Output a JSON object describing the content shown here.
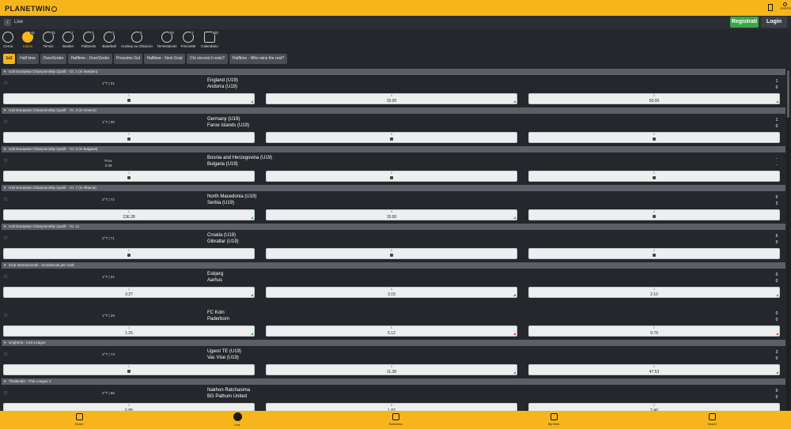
{
  "header": {
    "logo_text": "PLANETWIN",
    "user_label": "OSPITE"
  },
  "subbar": {
    "back": "‹",
    "title": "Live",
    "register": "Registrati",
    "login": "Login"
  },
  "sports": [
    {
      "label": "Cerca",
      "count": ""
    },
    {
      "label": "Calcio",
      "count": "40"
    },
    {
      "label": "Tennis",
      "count": "33"
    },
    {
      "label": "Basket",
      "count": "2"
    },
    {
      "label": "Pallavolo",
      "count": "1"
    },
    {
      "label": "Baseball",
      "count": "1"
    },
    {
      "label": "Hockey su Ghiaccio",
      "count": "4"
    },
    {
      "label": "Tennistavolo",
      "count": "53"
    },
    {
      "label": "Freccette",
      "count": "1"
    },
    {
      "label": "Calendario",
      "count": "487"
    }
  ],
  "tabs": [
    "1x2",
    "Half time",
    "Over/Under",
    "Halftime - Over/Under",
    "Prossimo Gol",
    "Halftime - Next Goal",
    "Chi vincerà il resto?",
    "Halftime - Who wins the rest?"
  ],
  "odd_headers": [
    "1",
    "X",
    "2"
  ],
  "events": [
    {
      "league": "U19 European Championship Qualif. - Gr. 1 (in Sweden)",
      "time": "1°T | 31",
      "time2": "",
      "home": "England (U19)",
      "away": "Andorra (U19)",
      "s1": "1",
      "s2": "0",
      "odds": [
        {
          "v": "",
          "lock": true,
          "t": "up"
        },
        {
          "v": "15.00",
          "lock": false,
          "t": "up"
        },
        {
          "v": "50.00",
          "lock": false,
          "t": "up"
        }
      ]
    },
    {
      "league": "U19 European Championship Qualif. - Gr. 2 (in Greece)",
      "time": "1°T | 30",
      "time2": "",
      "home": "Germany (U19)",
      "away": "Faroe Islands (U19)",
      "s1": "1",
      "s2": "0",
      "odds": [
        {
          "v": "",
          "lock": true,
          "t": ""
        },
        {
          "v": "",
          "lock": true,
          "t": ""
        },
        {
          "v": "",
          "lock": true,
          "t": ""
        }
      ]
    },
    {
      "league": "U19 European Championship Qualif. - Gr. 6 (in Bulgaria)",
      "time": "Prox",
      "time2": "2:30",
      "home": "Bosnia and Herzegovina (U19)",
      "away": "Bulgaria (U19)",
      "s1": "-",
      "s2": "-",
      "odds": [
        {
          "v": "",
          "lock": true,
          "t": ""
        },
        {
          "v": "",
          "lock": true,
          "t": ""
        },
        {
          "v": "",
          "lock": true,
          "t": ""
        }
      ]
    },
    {
      "league": "U19 European Championship Qualif. - Gr. 7 (in Albania)",
      "time": "2°T | 72",
      "time2": "",
      "home": "North Macedonia (U19)",
      "away": "Serbia (U19)",
      "s1": "0",
      "s2": "2",
      "odds": [
        {
          "v": "136.28",
          "lock": false,
          "t": "up"
        },
        {
          "v": "15.00",
          "lock": false,
          "t": "up"
        },
        {
          "v": "",
          "lock": true,
          "t": ""
        }
      ]
    },
    {
      "league": "U19 European Championship Qualif. - Gr. 11",
      "time": "2°T | 71",
      "time2": "",
      "home": "Croatia (U19)",
      "away": "Gibraltar (U19)",
      "s1": "6",
      "s2": "0",
      "odds": [
        {
          "v": "",
          "lock": true,
          "t": ""
        },
        {
          "v": "",
          "lock": true,
          "t": ""
        },
        {
          "v": "",
          "lock": true,
          "t": ""
        }
      ]
    },
    {
      "league": "Club Internazionali - Amichevole per Club",
      "time": "1°T | 31",
      "time2": "",
      "home": "Esbjerg",
      "away": "Aarhus",
      "s1": "0",
      "s2": "0",
      "odds": [
        {
          "v": "3.27",
          "lock": false,
          "t": "up"
        },
        {
          "v": "3.15",
          "lock": false,
          "t": "down"
        },
        {
          "v": "2.10",
          "lock": false,
          "t": "up"
        }
      ]
    },
    {
      "league": "",
      "time": "1°T | 29",
      "time2": "",
      "home": "FC Koln",
      "away": "Paderborn",
      "s1": "0",
      "s2": "0",
      "odds": [
        {
          "v": "1.25",
          "lock": false,
          "t": "up"
        },
        {
          "v": "5.12",
          "lock": false,
          "t": "down"
        },
        {
          "v": "9.79",
          "lock": false,
          "t": "down"
        }
      ]
    },
    {
      "league": "Ungheria - U19 League",
      "time": "2°T | 73",
      "time2": "",
      "home": "Ujpest TE (U19)",
      "away": "Vac Vise (U19)",
      "s1": "3",
      "s2": "0",
      "odds": [
        {
          "v": "",
          "lock": true,
          "t": ""
        },
        {
          "v": "11.38",
          "lock": false,
          "t": "up"
        },
        {
          "v": "47.53",
          "lock": false,
          "t": "up"
        }
      ]
    },
    {
      "league": "Thailandia - Thai League 1",
      "time": "2°T | 66",
      "time2": "",
      "home": "Nakhon Ratchasima",
      "away": "BG Pathum United",
      "s1": "0",
      "s2": "0",
      "odds": [
        {
          "v": "6.88",
          "lock": false,
          "t": "up"
        },
        {
          "v": "1.82",
          "lock": false,
          "t": "up"
        },
        {
          "v": "2.46",
          "lock": false,
          "t": "up"
        }
      ]
    }
  ],
  "bottom_nav": [
    "Home",
    "Live",
    "Schedina",
    "My Bets",
    "Giochi"
  ],
  "colors": {
    "brand": "#f6b51b",
    "bg": "#24272b",
    "league_bar": "#5b5f66",
    "up": "#3aa645",
    "down": "#d4333a"
  }
}
